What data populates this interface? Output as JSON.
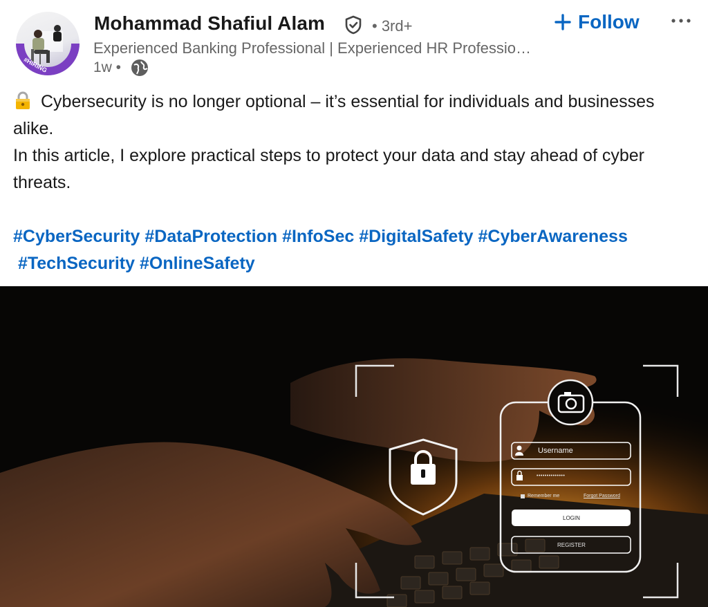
{
  "author": {
    "name": "Mohammad Shafiul Alam",
    "degree": "• 3rd+",
    "headline": "Experienced Banking Professional | Experienced HR Professio…",
    "time": "1w •",
    "avatar_badge": "#HIRING",
    "verified_icon": "shield-check-icon",
    "globe_icon": "globe-icon"
  },
  "actions": {
    "follow_label": "Follow",
    "more_icon": "ellipsis-icon"
  },
  "post": {
    "line1": "Cybersecurity is no longer optional – it’s essential for individuals and businesses alike.",
    "line2": "In this article, I explore practical steps to protect your data and stay ahead of cyber threats.",
    "hashtags": [
      "#CyberSecurity",
      "#DataProtection",
      "#InfoSec",
      "#DigitalSafety",
      "#CyberAwareness",
      "#TechSecurity",
      "#OnlineSafety"
    ]
  },
  "image": {
    "username_label": "Username",
    "password_mask": "••••••••••••••",
    "remember_label": "Remember me",
    "forgot_label": "Forgot Password",
    "login_label": "LOGIN",
    "register_label": "REGISTER"
  },
  "colors": {
    "link": "#0a66c2",
    "secondary_text": "#666666",
    "badge_purple": "#7b3fc2"
  }
}
